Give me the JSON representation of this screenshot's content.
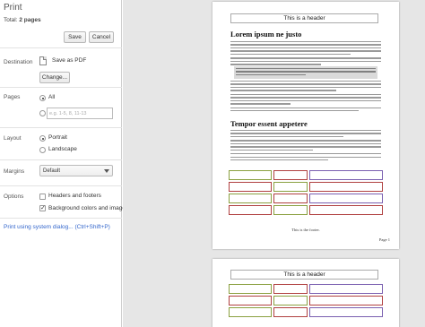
{
  "dialog": {
    "title": "Print",
    "total_label": "Total:",
    "total_value": "2 pages",
    "save_label": "Save",
    "cancel_label": "Cancel"
  },
  "destination": {
    "label": "Destination",
    "value": "Save as PDF",
    "change_label": "Change..."
  },
  "pages": {
    "label": "Pages",
    "all_label": "All",
    "range_placeholder": "e.g. 1-5, 8, 11-13",
    "selected": "All"
  },
  "layout": {
    "label": "Layout",
    "portrait_label": "Portrait",
    "landscape_label": "Landscape",
    "selected": "Portrait"
  },
  "margins": {
    "label": "Margins",
    "value": "Default"
  },
  "options": {
    "label": "Options",
    "headers_label": "Headers and footers",
    "headers_checked": false,
    "background_label": "Background colors and images",
    "background_checked": true
  },
  "system_dialog_link": "Print using system dialog... (Ctrl+Shift+P)",
  "preview": {
    "header_text": "This is a header",
    "heading1": "Lorem ipsum ne justo",
    "heading2": "Tempor essent appetere",
    "footer_text": "This is the footer.",
    "page_number": "Page 1",
    "page2_header_text": "This is a header"
  },
  "colors": {
    "link": "#3366cc",
    "preview_bg": "#e6e6e6",
    "table_border_a": "#b04040",
    "table_border_b": "#7a5fb0",
    "table_border_c": "#8aa040"
  }
}
